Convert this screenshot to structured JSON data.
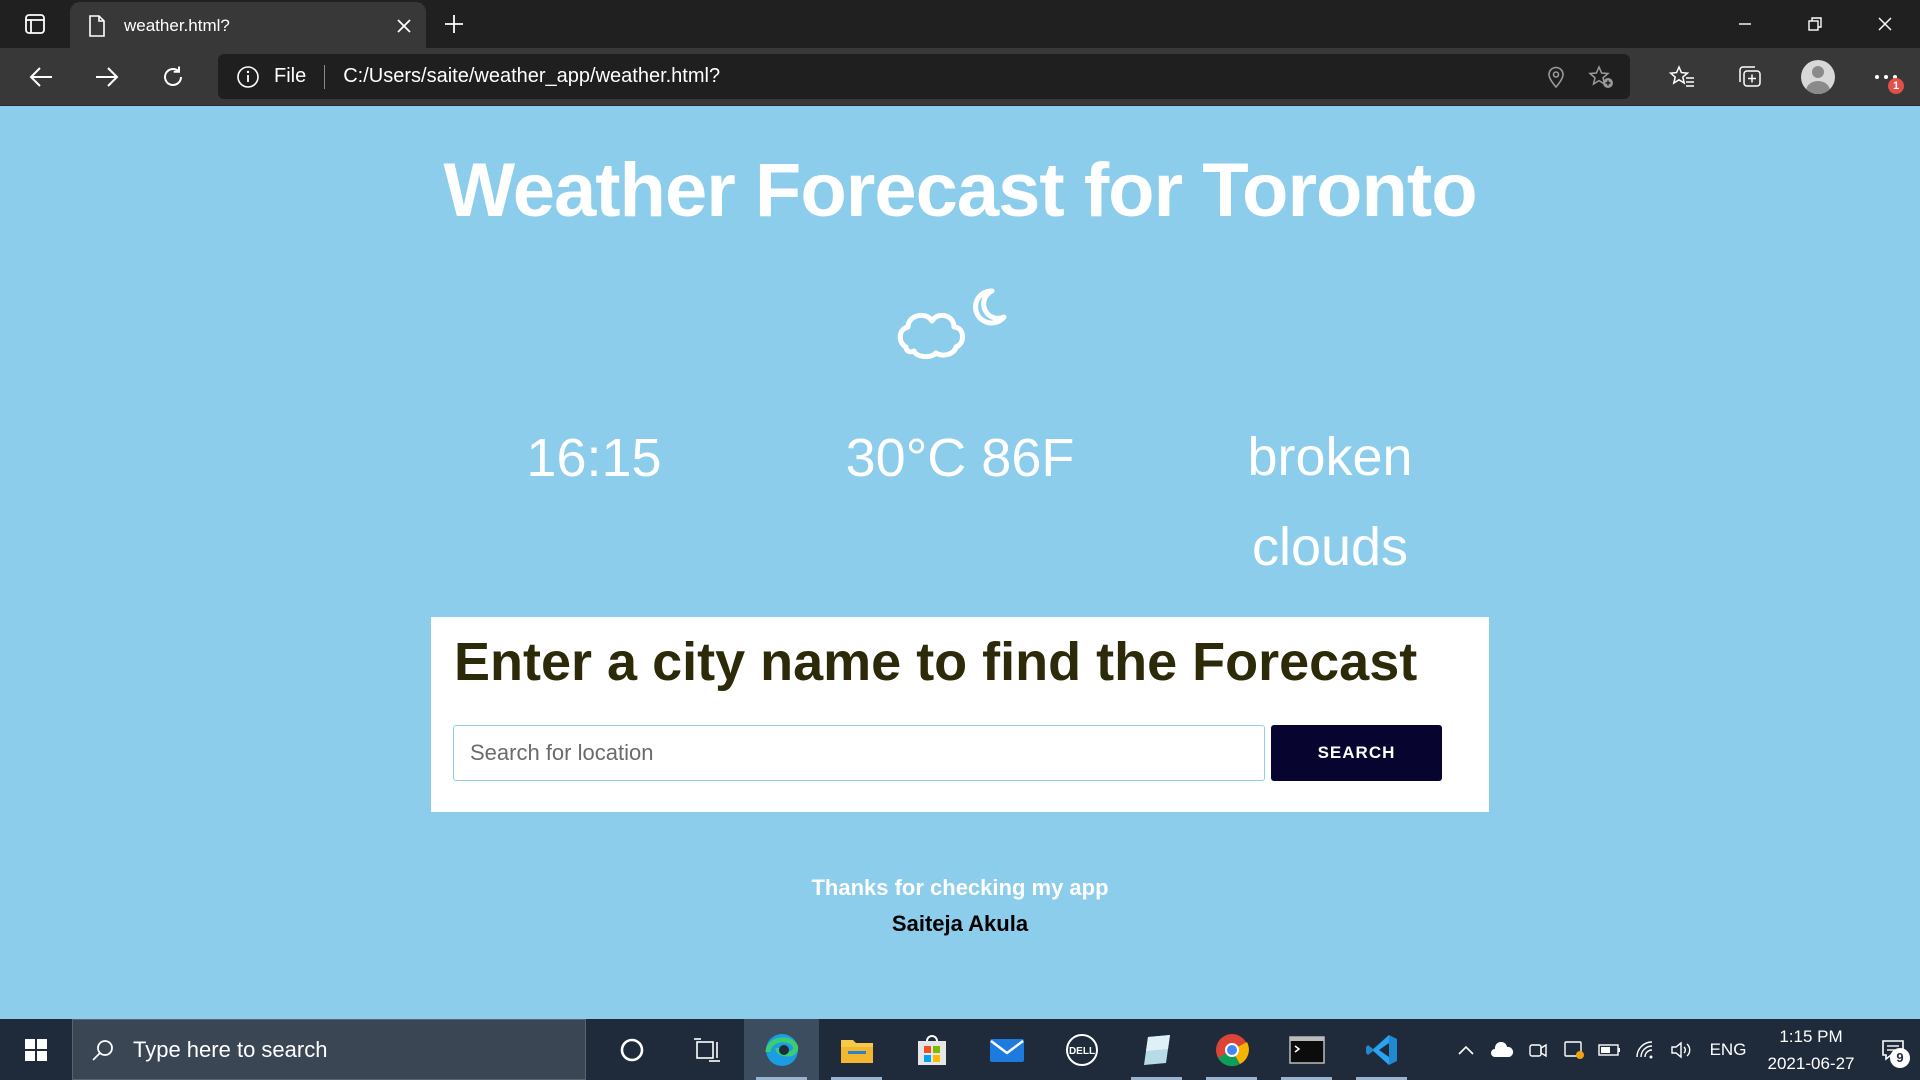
{
  "browser": {
    "tab_title": "weather.html?",
    "address_scheme": "File",
    "address_url": "C:/Users/saite/weather_app/weather.html?",
    "menu_badge": "1"
  },
  "page": {
    "title": "Weather Forecast for Toronto",
    "weather_icon": "cloud-moon-icon",
    "time": "16:15",
    "temperature": "30°C 86F",
    "description": "broken clouds",
    "search_heading": "Enter a city name to find the Forecast",
    "search_placeholder": "Search for location",
    "search_button": "SEARCH",
    "footer_thanks": "Thanks for checking my app",
    "footer_author": "Saiteja Akula"
  },
  "taskbar": {
    "search_placeholder": "Type here to search",
    "language": "ENG",
    "time": "1:15 PM",
    "date": "2021-06-27",
    "notification_count": "9"
  },
  "colors": {
    "page_background": "#8ccdec",
    "search_button": "#07052f",
    "heading_text": "#2d2a0a"
  }
}
